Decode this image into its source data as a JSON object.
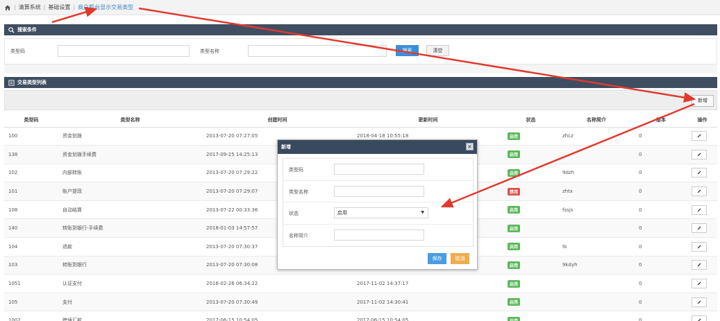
{
  "breadcrumb": {
    "items": [
      "清算系统",
      "基础设置",
      "商户柜台显示交易类型"
    ]
  },
  "search": {
    "title": "搜索条件",
    "type_code_label": "类型码",
    "type_code_value": "",
    "type_name_label": "类型名称",
    "type_name_value": "",
    "search_label": "搜索",
    "clear_label": "清空"
  },
  "list": {
    "title": "交易类型列表",
    "add_label": "新增",
    "columns": [
      "类型码",
      "类型名称",
      "创建时间",
      "更新时间",
      "状态",
      "名称简介",
      "版本",
      "操作"
    ],
    "rows": [
      {
        "code": "100",
        "name": "资金划拨",
        "created": "2013-07-20 07:27:05",
        "updated": "2018-04-18 10:55:18",
        "status": "启用",
        "status_on": true,
        "brief": "zhcz",
        "version": "0"
      },
      {
        "code": "138",
        "name": "资金划拨手续费",
        "created": "2017-09-25 14:25:13",
        "updated": "",
        "status": "启用",
        "status_on": true,
        "brief": "",
        "version": "0"
      },
      {
        "code": "102",
        "name": "内部转账",
        "created": "2013-07-20 07:29:22",
        "updated": "",
        "status": "启用",
        "status_on": true,
        "brief": "9dzh",
        "version": "0"
      },
      {
        "code": "101",
        "name": "账户提现",
        "created": "2013-07-20 07:29:07",
        "updated": "",
        "status": "禁用",
        "status_on": false,
        "brief": "zhtx",
        "version": "0"
      },
      {
        "code": "108",
        "name": "自动结算",
        "created": "2013-07-22 00:33:36",
        "updated": "",
        "status": "启用",
        "status_on": true,
        "brief": "fssjs",
        "version": "0"
      },
      {
        "code": "140",
        "name": "转账到银行-手续费",
        "created": "2018-01-03 14:57:57",
        "updated": "",
        "status": "启用",
        "status_on": true,
        "brief": "",
        "version": "0"
      },
      {
        "code": "104",
        "name": "退款",
        "created": "2013-07-20 07:30:37",
        "updated": "",
        "status": "启用",
        "status_on": true,
        "brief": "tk",
        "version": "0"
      },
      {
        "code": "103",
        "name": "转账到银行",
        "created": "2013-07-20 07:30:08",
        "updated": "",
        "status": "启用",
        "status_on": true,
        "brief": "9kdyh",
        "version": "0"
      },
      {
        "code": "1051",
        "name": "认证支付",
        "created": "2016-02-26 06:34:22",
        "updated": "2017-11-02 14:37:17",
        "status": "启用",
        "status_on": true,
        "brief": "",
        "version": "0"
      },
      {
        "code": "105",
        "name": "支付",
        "created": "2013-07-20 07:30:49",
        "updated": "2017-11-02 14:30:41",
        "status": "启用",
        "status_on": true,
        "brief": "",
        "version": "0"
      },
      {
        "code": "1002",
        "name": "跨境汇款",
        "created": "2017-06-15 10:54:05",
        "updated": "2017-06-15 10:54:05",
        "status": "启用",
        "status_on": true,
        "brief": "",
        "version": "0"
      }
    ]
  },
  "modal": {
    "title": "新增",
    "close_label": "×",
    "fields": {
      "type_code_label": "类型码",
      "type_code_value": "",
      "type_name_label": "类型名称",
      "type_name_value": "",
      "status_label": "状态",
      "status_value": "启用",
      "brief_label": "名称简介",
      "brief_value": ""
    },
    "save_label": "保存",
    "cancel_label": "取消"
  },
  "colors": {
    "header_bg": "#3f4e61",
    "badge_on": "#5cb85c",
    "badge_off": "#d9534f",
    "primary": "#3c8fd8",
    "warning": "#f0ad4e",
    "annotation_arrow": "#e03a2f"
  },
  "icons": [
    "home-icon",
    "search-icon",
    "list-icon",
    "pencil-icon",
    "close-icon",
    "caret-down-icon"
  ]
}
